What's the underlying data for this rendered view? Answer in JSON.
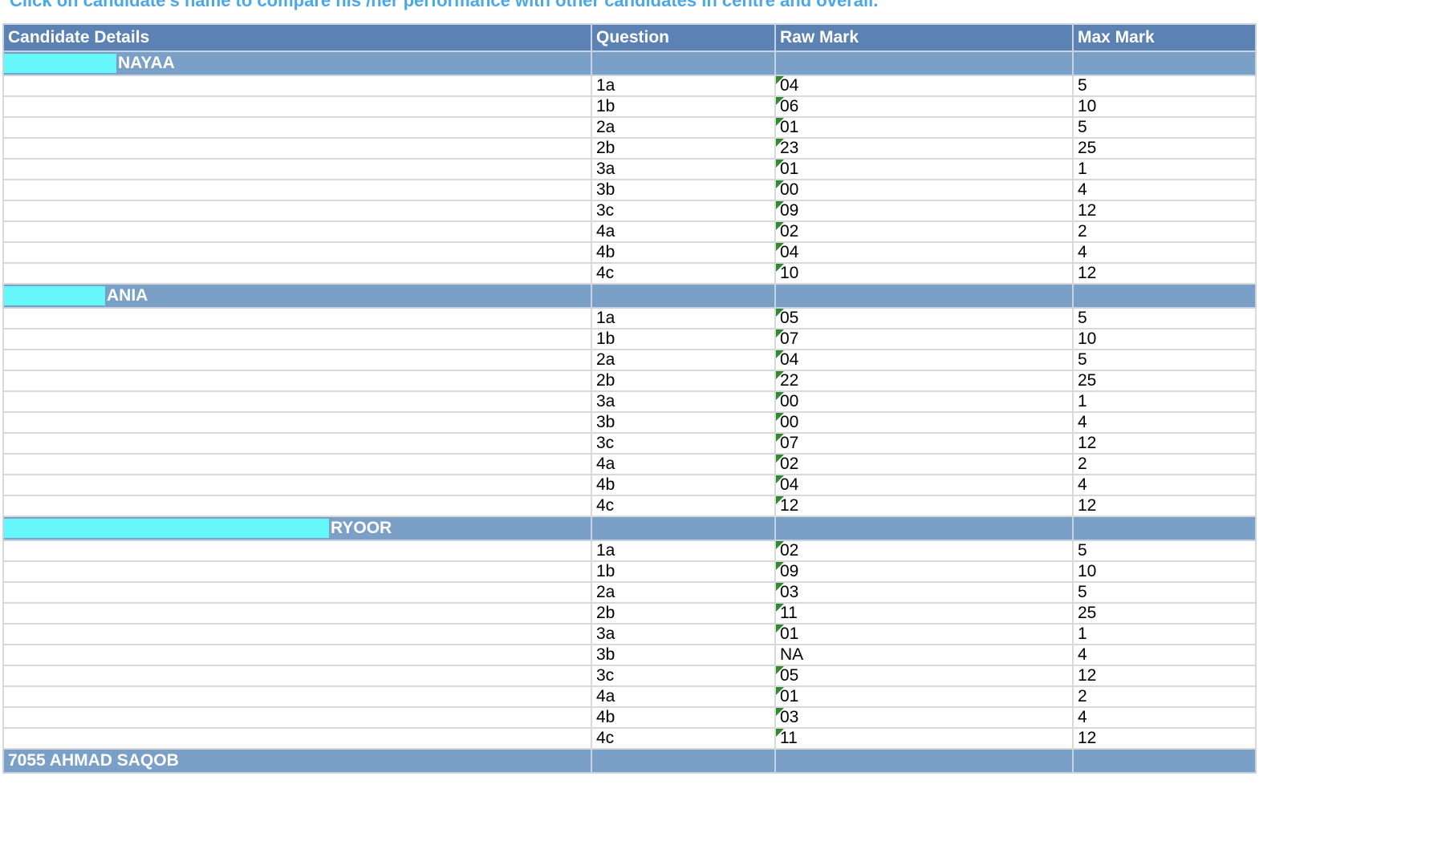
{
  "instruction": "Click on candidate's name to compare his /her performance with other candidates in centre and overall.",
  "colors": {
    "header_bg": "#5b82b3",
    "candidate_row_bg": "#7aa0c8",
    "redaction": "#66f7fb",
    "instruction_text": "#4aa8e8",
    "comment_flag": "#2f8a2f"
  },
  "table": {
    "headers": [
      "Candidate Details",
      "Question",
      "Raw Mark",
      "Max Mark"
    ],
    "candidates": [
      {
        "name_suffix": "NAYAA",
        "rows": [
          {
            "question": "1a",
            "raw": "04",
            "max": "5"
          },
          {
            "question": "1b",
            "raw": "06",
            "max": "10"
          },
          {
            "question": "2a",
            "raw": "01",
            "max": "5"
          },
          {
            "question": "2b",
            "raw": "23",
            "max": "25"
          },
          {
            "question": "3a",
            "raw": "01",
            "max": "1"
          },
          {
            "question": "3b",
            "raw": "00",
            "max": "4"
          },
          {
            "question": "3c",
            "raw": "09",
            "max": "12"
          },
          {
            "question": "4a",
            "raw": "02",
            "max": "2"
          },
          {
            "question": "4b",
            "raw": "04",
            "max": "4"
          },
          {
            "question": "4c",
            "raw": "10",
            "max": "12"
          }
        ]
      },
      {
        "name_suffix": "ANIA",
        "rows": [
          {
            "question": "1a",
            "raw": "05",
            "max": "5"
          },
          {
            "question": "1b",
            "raw": "07",
            "max": "10"
          },
          {
            "question": "2a",
            "raw": "04",
            "max": "5"
          },
          {
            "question": "2b",
            "raw": "22",
            "max": "25"
          },
          {
            "question": "3a",
            "raw": "00",
            "max": "1"
          },
          {
            "question": "3b",
            "raw": "00",
            "max": "4"
          },
          {
            "question": "3c",
            "raw": "07",
            "max": "12"
          },
          {
            "question": "4a",
            "raw": "02",
            "max": "2"
          },
          {
            "question": "4b",
            "raw": "04",
            "max": "4"
          },
          {
            "question": "4c",
            "raw": "12",
            "max": "12"
          }
        ]
      },
      {
        "name_suffix": "RYOOR",
        "rows": [
          {
            "question": "1a",
            "raw": "02",
            "max": "5"
          },
          {
            "question": "1b",
            "raw": "09",
            "max": "10"
          },
          {
            "question": "2a",
            "raw": "03",
            "max": "5"
          },
          {
            "question": "2b",
            "raw": "11",
            "max": "25"
          },
          {
            "question": "3a",
            "raw": "01",
            "max": "1"
          },
          {
            "question": "3b",
            "raw": "NA",
            "max": "4"
          },
          {
            "question": "3c",
            "raw": "05",
            "max": "12"
          },
          {
            "question": "4a",
            "raw": "01",
            "max": "2"
          },
          {
            "question": "4b",
            "raw": "03",
            "max": "4"
          },
          {
            "question": "4c",
            "raw": "11",
            "max": "12"
          }
        ]
      },
      {
        "name_suffix": "7055 AHMAD SAQOB",
        "rows": []
      }
    ]
  }
}
